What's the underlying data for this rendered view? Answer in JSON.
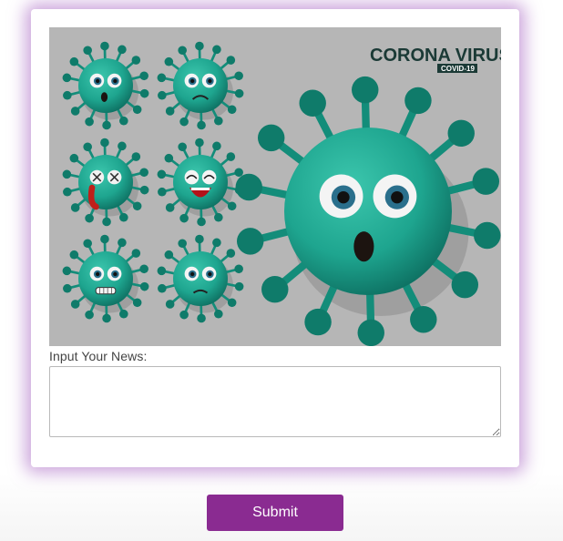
{
  "hero": {
    "title": "CORONA VIRUS",
    "subtitle": "COVID-19"
  },
  "form": {
    "news_label": "Input Your News:",
    "news_value": "",
    "news_placeholder": "",
    "submit_label": "Submit"
  },
  "colors": {
    "accent": "#8a2b91",
    "card_glow": "#b06ac0",
    "virus_body": "#1ea58f",
    "virus_dark": "#0e7566",
    "hero_background": "#b6b6b6"
  }
}
